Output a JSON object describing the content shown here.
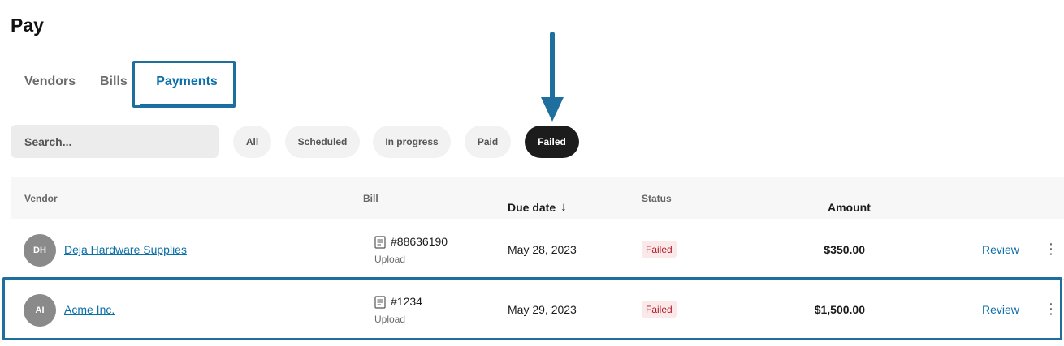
{
  "page": {
    "title": "Pay"
  },
  "tabs": [
    {
      "label": "Vendors"
    },
    {
      "label": "Bills"
    },
    {
      "label": "Payments",
      "active": true
    }
  ],
  "search": {
    "placeholder": "Search...",
    "value": ""
  },
  "filters": [
    {
      "label": "All"
    },
    {
      "label": "Scheduled"
    },
    {
      "label": "In progress"
    },
    {
      "label": "Paid"
    },
    {
      "label": "Failed",
      "selected": true
    }
  ],
  "table": {
    "columns": {
      "vendor": "Vendor",
      "bill": "Bill",
      "due_date": "Due date",
      "status": "Status",
      "amount": "Amount"
    },
    "sort_arrow": "↓",
    "rows": [
      {
        "initials": "DH",
        "vendor": "Deja Hardware Supplies",
        "bill_number": "#88636190",
        "bill_source": "Upload",
        "due_date": "May 28, 2023",
        "status": "Failed",
        "amount": "$350.00",
        "action": "Review"
      },
      {
        "initials": "AI",
        "vendor": "Acme Inc.",
        "bill_number": "#1234",
        "bill_source": "Upload",
        "due_date": "May 29, 2023",
        "status": "Failed",
        "amount": "$1,500.00",
        "action": "Review",
        "highlighted": true
      }
    ]
  },
  "colors": {
    "accent": "#0b6fa8",
    "highlight_border": "#1f6f9e",
    "failed_text": "#b21a28",
    "failed_bg": "#fbe9ea",
    "chip_selected": "#1c1c1c"
  },
  "icons": {
    "bill": "receipt-icon",
    "more": "more-vertical-icon",
    "sort": "arrow-down-icon",
    "callout": "callout-arrow-icon"
  }
}
